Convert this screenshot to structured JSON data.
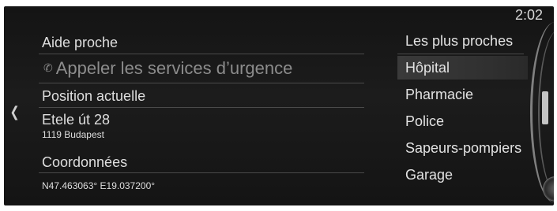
{
  "status": {
    "time": "2:02"
  },
  "left": {
    "section_title": "Aide proche",
    "emergency_call_label": "Appeler les services d’urgence",
    "position_heading": "Position actuelle",
    "address_line1": "Etele út 28",
    "address_line2": "1119 Budapest",
    "coordinates_heading": "Coordonnées",
    "coordinates_value": "N47.463063° E19.037200°"
  },
  "right": {
    "items": [
      {
        "label": "Les plus proches",
        "selected": false
      },
      {
        "label": "Hôpital",
        "selected": true
      },
      {
        "label": "Pharmacie",
        "selected": false
      },
      {
        "label": "Police",
        "selected": false
      },
      {
        "label": "Sapeurs-pompiers",
        "selected": false
      },
      {
        "label": "Garage",
        "selected": false
      }
    ]
  }
}
